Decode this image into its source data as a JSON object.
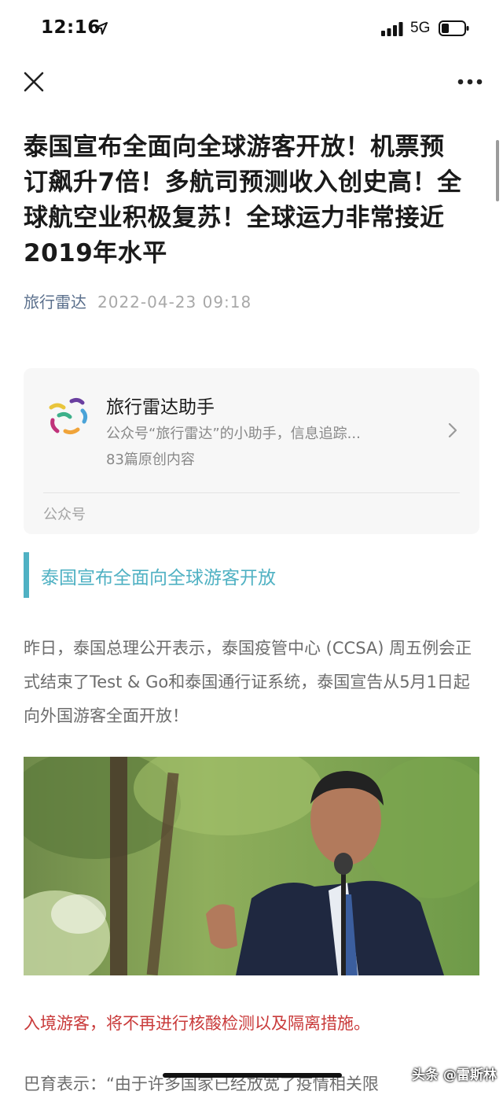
{
  "status_bar": {
    "time": "12:16",
    "network": "5G"
  },
  "article": {
    "title": "泰国宣布全面向全球游客开放！机票预订飙升7倍！多航司预测收入创史高！全球航空业积极复苏！全球运力非常接近2019年水平",
    "author": "旅行雷达",
    "date": "2022-04-23 09:18"
  },
  "account_card": {
    "name": "旅行雷达助手",
    "description": "公众号“旅行雷达”的小助手，信息追踪...",
    "count": "83篇原创内容",
    "type_label": "公众号"
  },
  "section_heading": "泰国宣布全面向全球游客开放",
  "paragraph": "昨日，泰国总理公开表示，泰国疫管中心 (CCSA) 周五例会正式结束了Test & Go和泰国通行证系统，泰国宣告从5月1日起向外国游客全面开放！",
  "highlight": "入境游客，将不再进行核酸检测以及隔离措施。",
  "next_line": "巴育表示：“由于许多国家已经放宽了疫情相关限",
  "watermark": "头条 @雷斯林",
  "colors": {
    "accent": "#4fb1c3",
    "highlight": "#c93a3a",
    "author": "#5a6f8c"
  }
}
